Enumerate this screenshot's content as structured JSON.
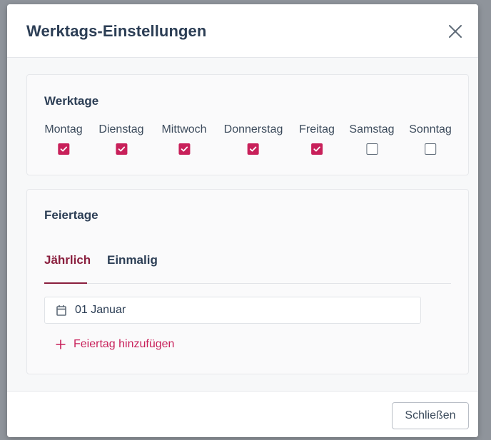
{
  "dialog": {
    "title": "Werktags-Einstellungen",
    "close_icon": "close-icon"
  },
  "workdays": {
    "title": "Werktage",
    "days": [
      {
        "label": "Montag",
        "checked": true
      },
      {
        "label": "Dienstag",
        "checked": true
      },
      {
        "label": "Mittwoch",
        "checked": true
      },
      {
        "label": "Donnerstag",
        "checked": true
      },
      {
        "label": "Freitag",
        "checked": true
      },
      {
        "label": "Samstag",
        "checked": false
      },
      {
        "label": "Sonntag",
        "checked": false
      }
    ]
  },
  "holidays": {
    "title": "Feiertage",
    "tabs": [
      {
        "label": "Jährlich",
        "active": true
      },
      {
        "label": "Einmalig",
        "active": false
      }
    ],
    "entries": [
      {
        "date": "01 Januar",
        "icon": "calendar-icon"
      }
    ],
    "add_label": "Feiertag hinzufügen",
    "add_icon": "plus-icon"
  },
  "footer": {
    "close_label": "Schließen"
  },
  "colors": {
    "accent": "#c8205a",
    "tab_active": "#8a1f3e",
    "heading": "#2c3e55"
  }
}
